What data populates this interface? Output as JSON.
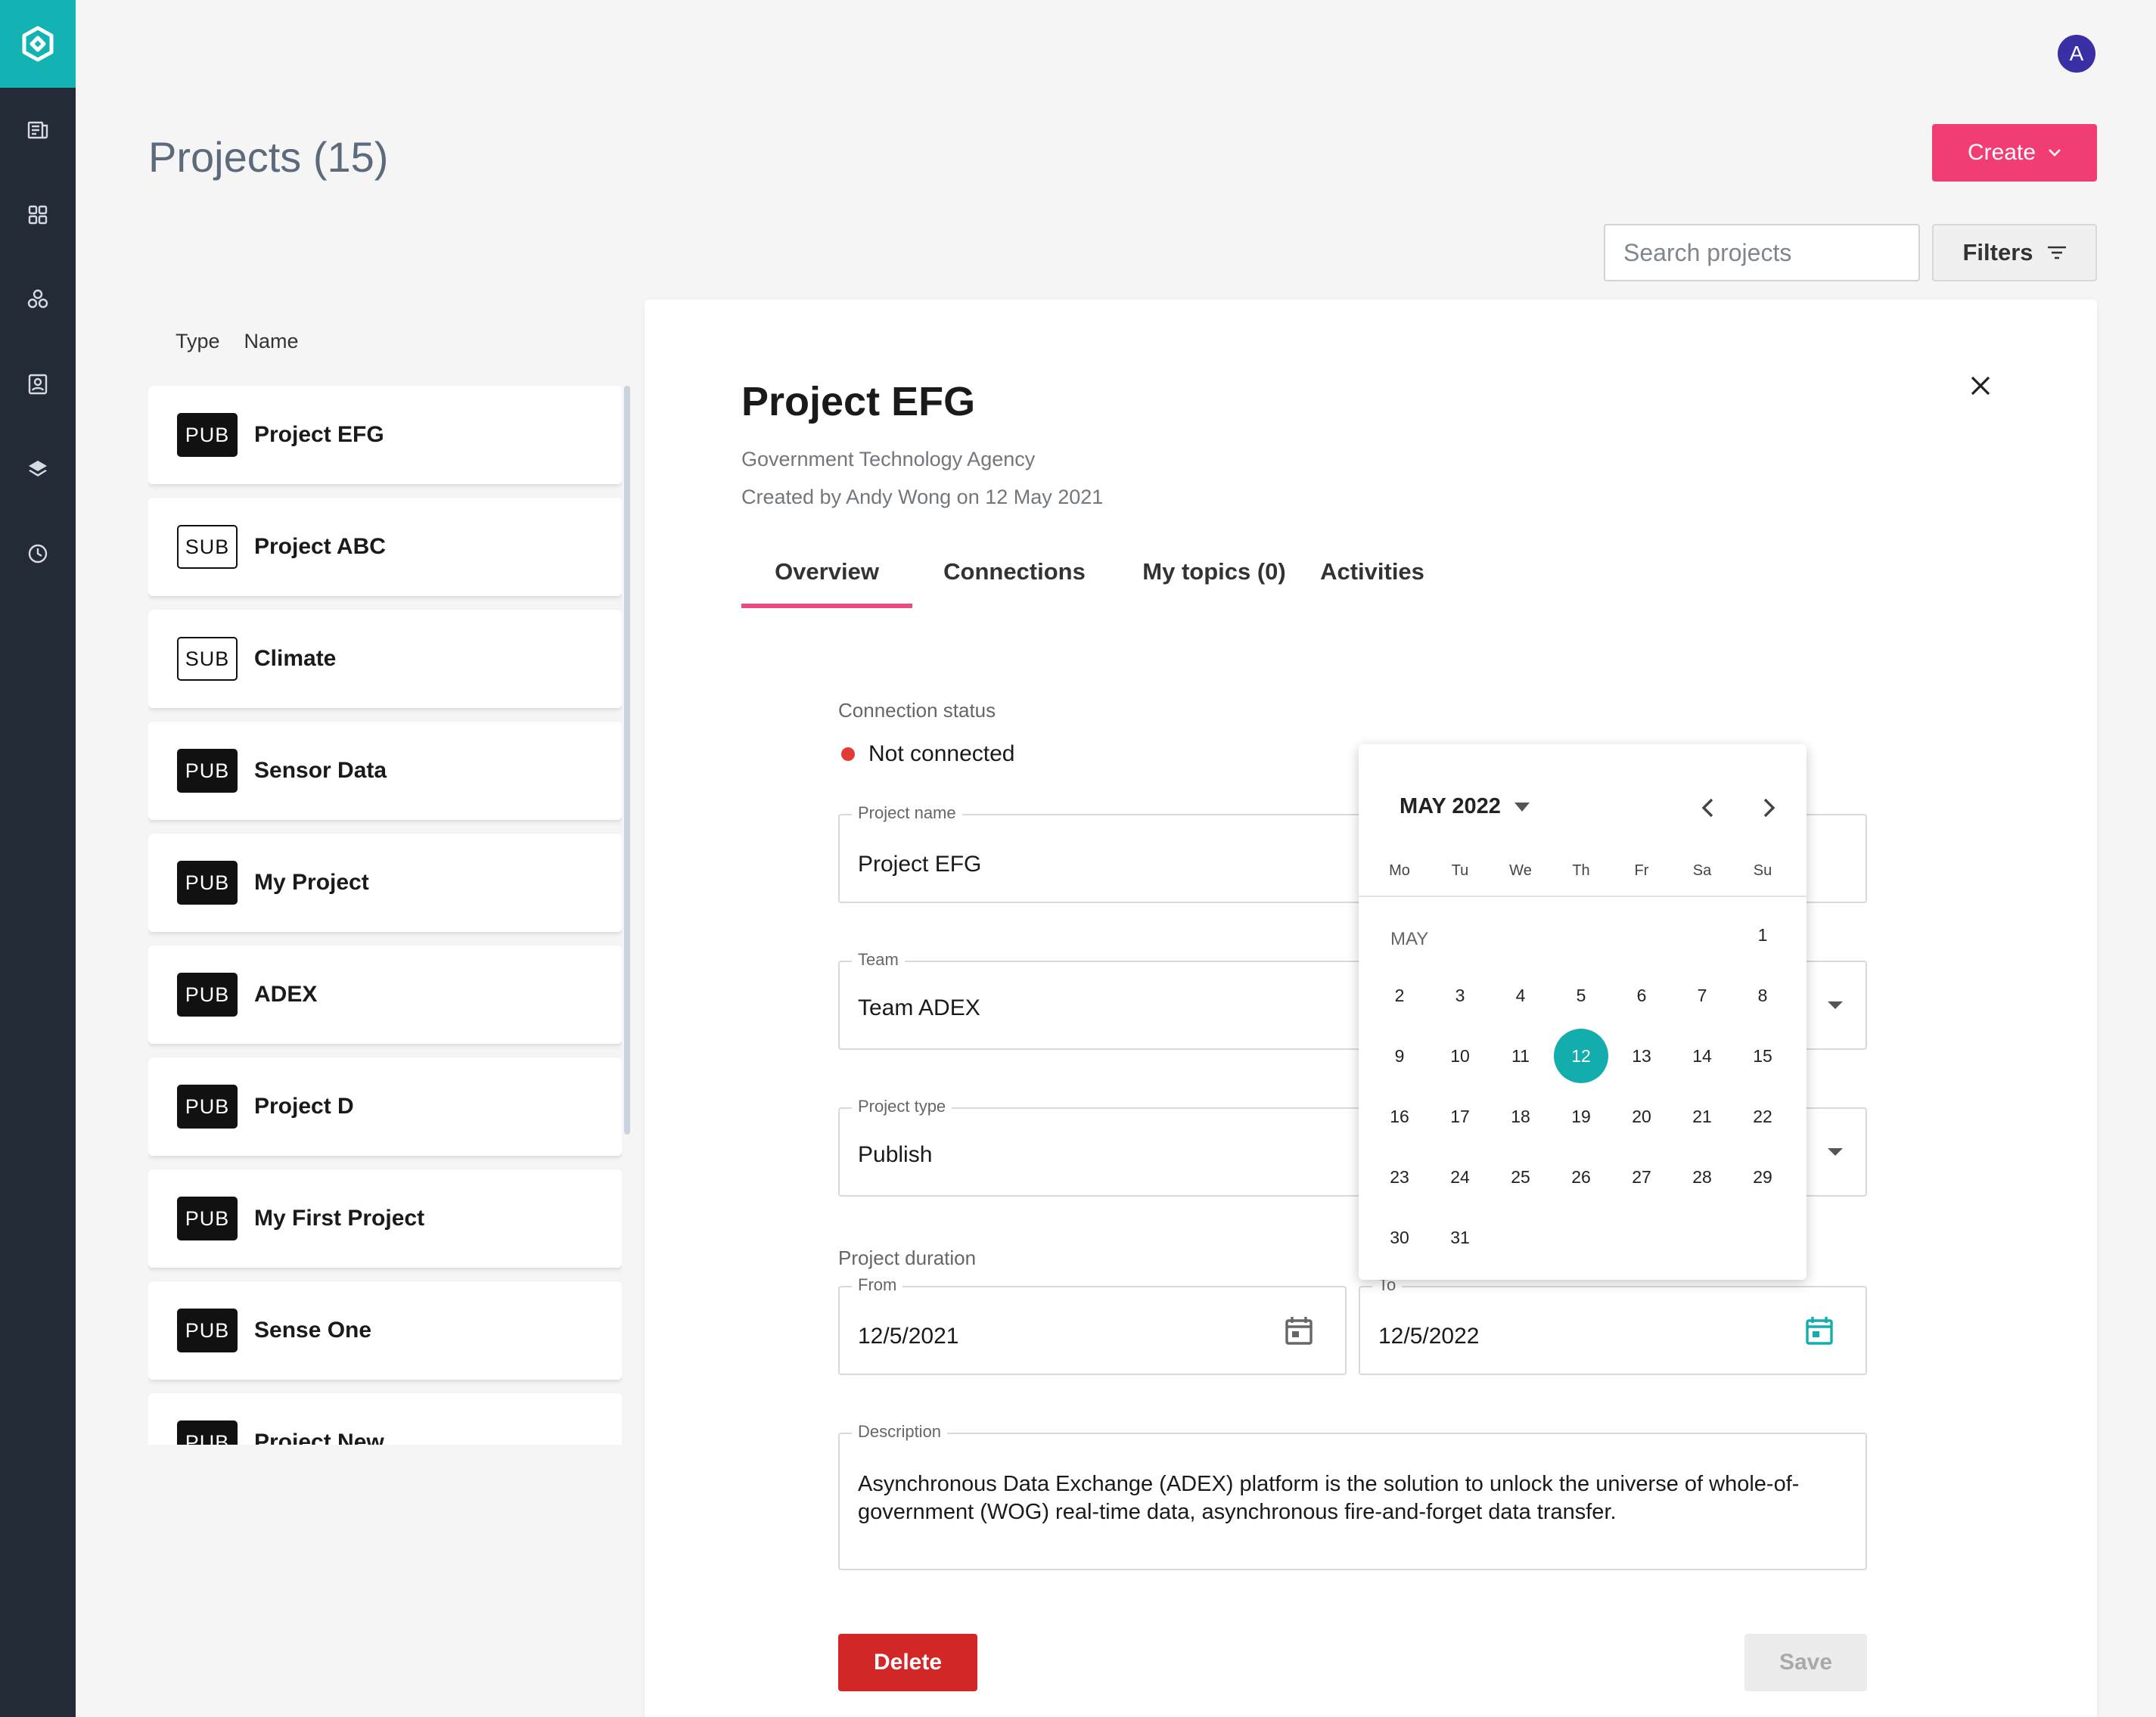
{
  "header": {
    "page_title": "Projects (15)",
    "avatar_initial": "A",
    "create_label": "Create",
    "search_placeholder": "Search projects",
    "filters_label": "Filters"
  },
  "sidebar": {
    "items": [
      {
        "icon": "news-icon"
      },
      {
        "icon": "grid-icon"
      },
      {
        "icon": "nodes-icon"
      },
      {
        "icon": "contact-icon"
      },
      {
        "icon": "layers-icon"
      },
      {
        "icon": "clock-icon"
      }
    ]
  },
  "list": {
    "col_type": "Type",
    "col_name": "Name",
    "projects": [
      {
        "type": "PUB",
        "name": "Project EFG"
      },
      {
        "type": "SUB",
        "name": "Project ABC"
      },
      {
        "type": "SUB",
        "name": "Climate"
      },
      {
        "type": "PUB",
        "name": "Sensor Data"
      },
      {
        "type": "PUB",
        "name": "My Project"
      },
      {
        "type": "PUB",
        "name": "ADEX"
      },
      {
        "type": "PUB",
        "name": "Project D"
      },
      {
        "type": "PUB",
        "name": "My First Project"
      },
      {
        "type": "PUB",
        "name": "Sense One"
      },
      {
        "type": "PUB",
        "name": "Project New"
      }
    ]
  },
  "detail": {
    "title": "Project EFG",
    "organization": "Government Technology Agency",
    "created": "Created by Andy Wong on 12 May 2021",
    "tabs": [
      {
        "label": "Overview",
        "active": true
      },
      {
        "label": "Connections",
        "active": false
      },
      {
        "label": "My topics (0)",
        "active": false
      },
      {
        "label": "Activities",
        "active": false
      }
    ],
    "connection_status_label": "Connection status",
    "connection_status_value": "Not connected",
    "project_name_label": "Project name",
    "project_name_value": "Project EFG",
    "team_label": "Team",
    "team_value": "Team ADEX",
    "project_type_label": "Project type",
    "project_type_value": "Publish",
    "duration_label": "Project duration",
    "from_label": "From",
    "from_value": "12/5/2021",
    "to_label": "To",
    "to_value": "12/5/2022",
    "description_label": "Description",
    "description_value": "Asynchronous Data Exchange (ADEX) platform is the solution to unlock the universe of whole-of-government (WOG) real-time data, asynchronous fire-and-forget data transfer.",
    "delete_label": "Delete",
    "save_label": "Save"
  },
  "datepicker": {
    "month_year": "MAY 2022",
    "month_label": "MAY",
    "weekdays": [
      "Mo",
      "Tu",
      "We",
      "Th",
      "Fr",
      "Sa",
      "Su"
    ],
    "first_day_column": 6,
    "days_in_month": 31,
    "selected_day": 12,
    "accent_color": "#14adad"
  },
  "colors": {
    "sidebar_bg": "#232b36",
    "logo_bg": "#14b3b3",
    "create_button": "#f23c74",
    "tab_indicator": "#e94b7d",
    "delete_button": "#d32626",
    "status_dot": "#e53935",
    "avatar_bg": "#3b2fa6"
  }
}
